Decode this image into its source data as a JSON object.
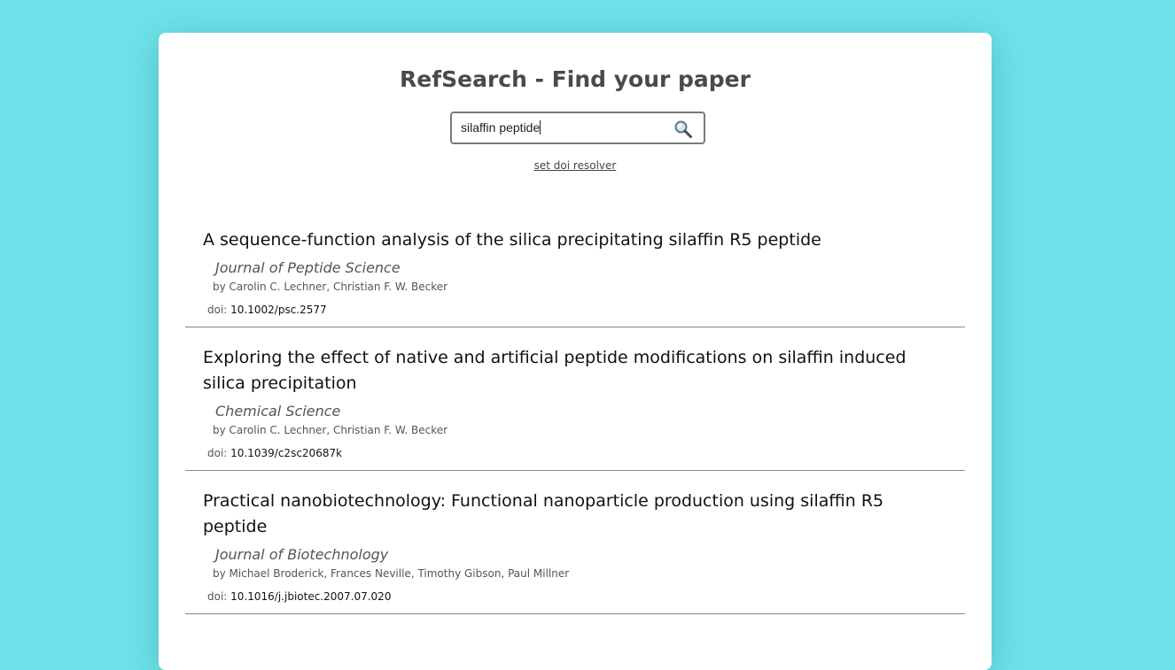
{
  "header": {
    "title": "RefSearch - Find your paper"
  },
  "search": {
    "value": "silaffin peptide",
    "icon": "search-icon"
  },
  "links": {
    "resolver": "set doi resolver"
  },
  "results": [
    {
      "title": "A sequence-function analysis of the silica precipitating silaffin R5 peptide",
      "journal": "Journal of Peptide Science",
      "authors": "by Carolin C. Lechner, Christian F. W. Becker",
      "doi_label": "doi:",
      "doi": "10.1002/psc.2577"
    },
    {
      "title": "Exploring the effect of native and artificial peptide modifications on silaffin induced silica precipitation",
      "journal": "Chemical Science",
      "authors": "by Carolin C. Lechner, Christian F. W. Becker",
      "doi_label": "doi:",
      "doi": "10.1039/c2sc20687k"
    },
    {
      "title": "Practical nanobiotechnology: Functional nanoparticle production using silaffin R5 peptide",
      "journal": "Journal of Biotechnology",
      "authors": "by Michael Broderick, Frances Neville, Timothy Gibson, Paul Millner",
      "doi_label": "doi:",
      "doi": "10.1016/j.jbiotec.2007.07.020"
    }
  ],
  "colors": {
    "background": "#6ee2ea",
    "card": "#ffffff",
    "title": "#4a4a4a"
  }
}
